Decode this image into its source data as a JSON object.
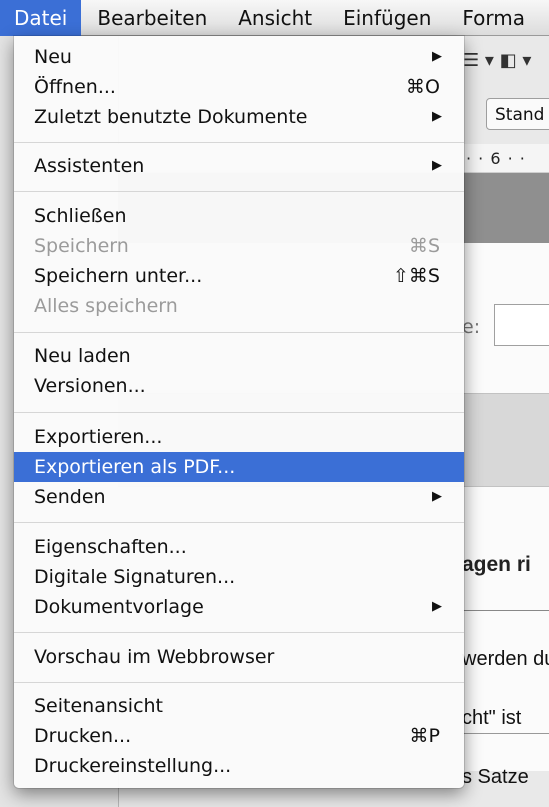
{
  "menubar": {
    "items": [
      "Datei",
      "Bearbeiten",
      "Ansicht",
      "Einfügen",
      "Forma"
    ]
  },
  "background": {
    "toolbar_glyphs": "☰ ▾ ◧ ▾",
    "paragraph_style": "Stand",
    "ruler": "· · 6 · ·",
    "field_label": "e:",
    "heading": "agen ri",
    "lines": [
      "werden du",
      "cht\" ist",
      "s Satze"
    ]
  },
  "menu": {
    "items": [
      {
        "label": "Neu",
        "submenu": true
      },
      {
        "label": "Öffnen...",
        "shortcut": "⌘O"
      },
      {
        "label": "Zuletzt benutzte Dokumente",
        "submenu": true
      },
      {
        "label": "Assistenten",
        "submenu": true
      },
      {
        "label": "Schließen"
      },
      {
        "label": "Speichern",
        "shortcut": "⌘S",
        "disabled": true
      },
      {
        "label": "Speichern unter...",
        "shortcut": "⇧⌘S"
      },
      {
        "label": "Alles speichern",
        "disabled": true
      },
      {
        "label": "Neu laden"
      },
      {
        "label": "Versionen..."
      },
      {
        "label": "Exportieren..."
      },
      {
        "label": "Exportieren als PDF...",
        "highlighted": true
      },
      {
        "label": "Senden",
        "submenu": true
      },
      {
        "label": "Eigenschaften..."
      },
      {
        "label": "Digitale Signaturen..."
      },
      {
        "label": "Dokumentvorlage",
        "submenu": true
      },
      {
        "label": "Vorschau im Webbrowser"
      },
      {
        "label": "Seitenansicht"
      },
      {
        "label": "Drucken...",
        "shortcut": "⌘P"
      },
      {
        "label": "Druckereinstellung..."
      }
    ]
  },
  "colors": {
    "highlight": "#3b6fd6",
    "disabled_text": "#9b9b9b"
  }
}
